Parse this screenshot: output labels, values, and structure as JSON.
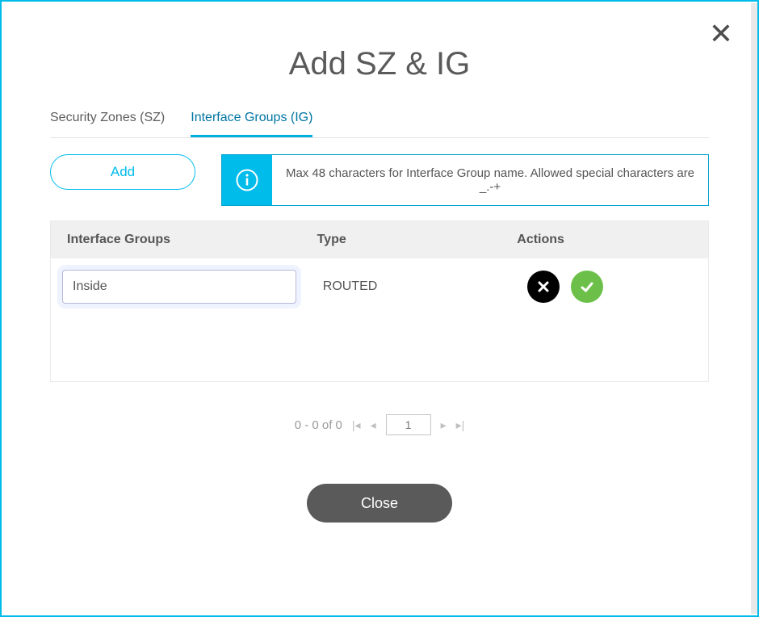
{
  "title": "Add SZ & IG",
  "close_x": "✕",
  "tabs": {
    "sz": "Security Zones (SZ)",
    "ig": "Interface Groups (IG)"
  },
  "toolbar": {
    "add_label": "Add",
    "info_text": "Max 48 characters for Interface Group name. Allowed special characters are _.-+"
  },
  "table": {
    "headers": {
      "name": "Interface Groups",
      "type": "Type",
      "actions": "Actions"
    },
    "rows": [
      {
        "name": "Inside",
        "type": "ROUTED"
      }
    ]
  },
  "pagination": {
    "range": "0 - 0 of 0",
    "page": "1"
  },
  "footer": {
    "close": "Close"
  }
}
